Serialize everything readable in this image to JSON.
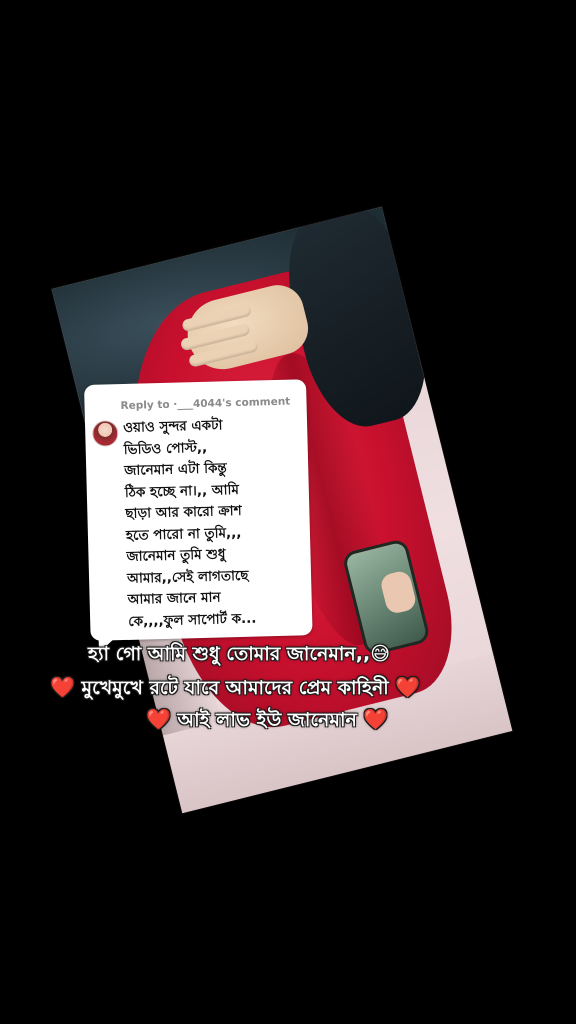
{
  "reply": {
    "header": "Reply to ·___4044's comment",
    "lines": [
      "ওয়াও সুন্দর একটা",
      "ভিডিও পোস্ট,,",
      "জানেমান এটা কিন্তু",
      "ঠিক হচ্ছে না।,, আমি",
      "ছাড়া আর কারো ক্রাশ",
      "হতে পারো না তুমি,,,",
      "জানেমান তুমি শুধু",
      "আমার,,সেই লাগতাছে",
      "আমার জানে মান",
      "কে,,,,ফুল সাপোর্ট ক..."
    ]
  },
  "captions": {
    "line1_text": "হ্যা গো আমি শুধু তোমার জানেমান,,",
    "line1_emoji": "😅",
    "line2_heart_left": "❤️",
    "line2_text": " মুখেমুখে রটে যাবে আমাদের প্রেম কাহিনী ",
    "line2_heart_right": "❤️",
    "line3_heart_left": "❤️",
    "line3_text": " আই লাভ ইউ জানেমান ",
    "line3_heart_right": "❤️"
  },
  "colors": {
    "background": "#000000",
    "jacket": "#c8102e",
    "heart": "#e0202e",
    "bubble": "#ffffff"
  }
}
